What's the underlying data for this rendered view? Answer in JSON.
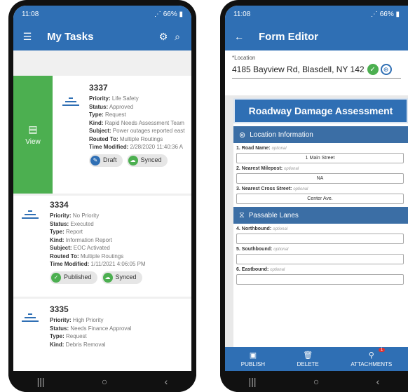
{
  "left": {
    "status": {
      "time": "11:08",
      "battery": "66%"
    },
    "appbar": {
      "title": "My Tasks"
    },
    "view_label": "View",
    "labels": {
      "priority": "Priority:",
      "status": "Status:",
      "type": "Type:",
      "kind": "Kind:",
      "subject": "Subject:",
      "routed": "Routed To:",
      "modified": "Time Modified:"
    },
    "tasks": [
      {
        "number": "3337",
        "priority": "Life Safety",
        "status": "Approved",
        "type": "Request",
        "kind": "Rapid Needs Assessment Team",
        "subject": "Power outages reported east",
        "routed": "Multiple Routings",
        "modified": "2/28/2020 11:40:36 A",
        "chip1": "Draft",
        "chip2": "Synced"
      },
      {
        "number": "3334",
        "priority": "No Priority",
        "status": "Executed",
        "type": "Report",
        "kind": "Information Report",
        "subject": "EOC Activated",
        "routed": "Multiple Routings",
        "modified": "1/11/2021 4:06:05 PM",
        "chip1": "Published",
        "chip2": "Synced"
      },
      {
        "number": "3335",
        "priority": "High Priority",
        "status": "Needs Finance Approval",
        "type": "Request",
        "kind": "Debris Removal"
      }
    ]
  },
  "right": {
    "status": {
      "time": "11:08",
      "battery": "66%"
    },
    "appbar": {
      "title": "Form Editor"
    },
    "location": {
      "label": "*Location",
      "value": "4185 Bayview Rd, Blasdell, NY 142"
    },
    "form_title": "Roadway Damage Assessment",
    "sections": {
      "s1": "Location Information",
      "s2": "Passable Lanes"
    },
    "optional": "optional",
    "fields": [
      {
        "label": "1. Road Name:",
        "value": "1 Main Street"
      },
      {
        "label": "2. Nearest Milepost:",
        "value": "NA"
      },
      {
        "label": "3. Nearest Cross Street:",
        "value": "Center Ave."
      },
      {
        "label": "4. Northbound:",
        "value": ""
      },
      {
        "label": "5. Southbound:",
        "value": ""
      },
      {
        "label": "6. Eastbound:",
        "value": ""
      }
    ],
    "bottom": {
      "publish": "PUBLISH",
      "delete": "DELETE",
      "attachments": "ATTACHMENTS",
      "badge": "1"
    }
  }
}
